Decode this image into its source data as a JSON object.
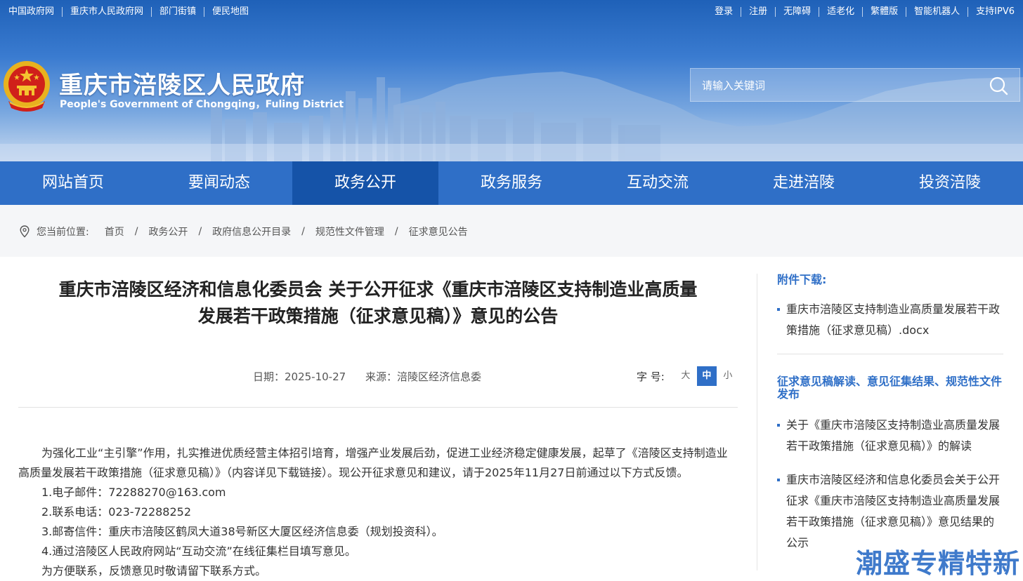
{
  "topbar": {
    "left_links": [
      "中国政府网",
      "重庆市人民政府网",
      "部门街镇",
      "便民地图"
    ],
    "right_links": [
      "登录",
      "注册",
      "无障碍",
      "适老化",
      "繁體版",
      "智能机器人",
      "支持IPV6"
    ]
  },
  "site": {
    "title": "重庆市涪陵区人民政府",
    "subtitle": "People's Government of Chongqing，Fuling District"
  },
  "search": {
    "placeholder": "请输入关键词"
  },
  "nav": {
    "items": [
      "网站首页",
      "要闻动态",
      "政务公开",
      "政务服务",
      "互动交流",
      "走进涪陵",
      "投资涪陵"
    ],
    "active": "政务公开"
  },
  "breadcrumb": {
    "label": "您当前位置:",
    "items": [
      "首页",
      "政务公开",
      "政府信息公开目录",
      "规范性文件管理",
      "征求意见公告"
    ]
  },
  "article": {
    "title_line1": "重庆市涪陵区经济和信息化委员会 关于公开征求《重庆市涪陵区支持制造业高质量",
    "title_line2": "发展若干政策措施（征求意见稿）》意见的公告",
    "date": "日期：2025-10-27",
    "source": "来源：涪陵区经济信息委",
    "font_size_label": "字  号:",
    "font_sizes": [
      "大",
      "中",
      "小"
    ],
    "font_size_active": "中",
    "para1": "为强化工业“主引擎”作用，扎实推进优质经营主体招引培育，增强产业发展后劲，促进工业经济稳定健康发展，起草了《涪陵区支持制造业高质量发展若干政策措施（征求意见稿）》（内容详见下载链接）。现公开征求意见和建议，请于2025年11月27日前通过以下方式反馈。",
    "items": [
      "1.电子邮件：72288270@163.com",
      "2.联系电话：023-72288252",
      "3.邮寄信件：重庆市涪陵区鹤凤大道38号新区大厦区经济信息委（规划投资科）。",
      "4.通过涪陵区人民政府网站“互动交流”在线征集栏目填写意见。"
    ],
    "para_cut": "为方便联系，反馈意见时敬请留下联系方式。"
  },
  "sidebar": {
    "attach_heading": "附件下载:",
    "attachments": [
      "重庆市涪陵区支持制造业高质量发展若干政策措施（征求意见稿）.docx"
    ],
    "related_heading": "征求意见稿解读、意见征集结果、规范性文件发布",
    "related": [
      "关于《重庆市涪陵区支持制造业高质量发展若干政策措施（征求意见稿）》的解读",
      "重庆市涪陵区经济和信息化委员会关于公开征求《重庆市涪陵区支持制造业高质量发展若干政策措施（征求意见稿）》意见结果的公示"
    ]
  },
  "watermark": "潮盛专精特新",
  "colors": {
    "primary": "#2f6fc7",
    "nav_active": "#1553a8"
  }
}
